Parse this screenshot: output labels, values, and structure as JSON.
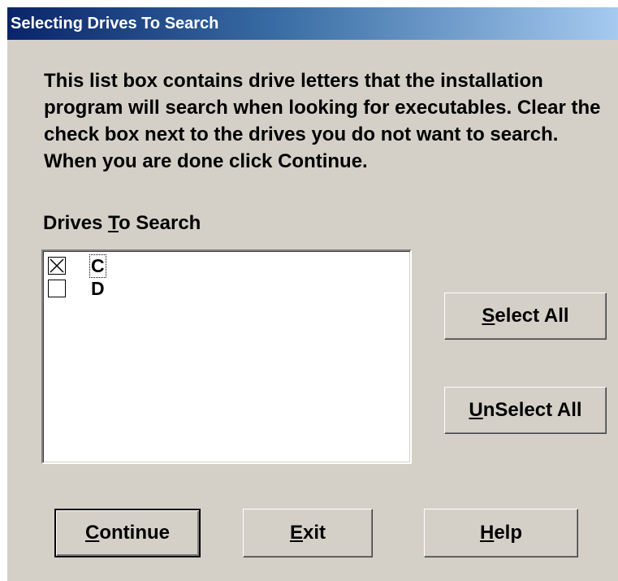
{
  "window": {
    "title": "Selecting Drives To Search"
  },
  "description": "This list box contains drive letters that the installation program will search when looking for executables. Clear the check box next to the drives you do not want to search. When you are done click Continue.",
  "drives_list": {
    "label_before": "Drives ",
    "label_mnemonic": "T",
    "label_after": "o Search",
    "items": [
      {
        "letter": "C",
        "checked": true,
        "focused": true
      },
      {
        "letter": "D",
        "checked": false,
        "focused": false
      }
    ]
  },
  "buttons": {
    "select_all": {
      "mnemonic": "S",
      "rest": "elect All"
    },
    "unselect_all": {
      "mnemonic": "U",
      "rest": "nSelect All"
    },
    "continue": {
      "mnemonic": "C",
      "rest": "ontinue"
    },
    "exit": {
      "mnemonic": "E",
      "rest": "xit"
    },
    "help": {
      "mnemonic": "H",
      "rest": "elp"
    }
  }
}
